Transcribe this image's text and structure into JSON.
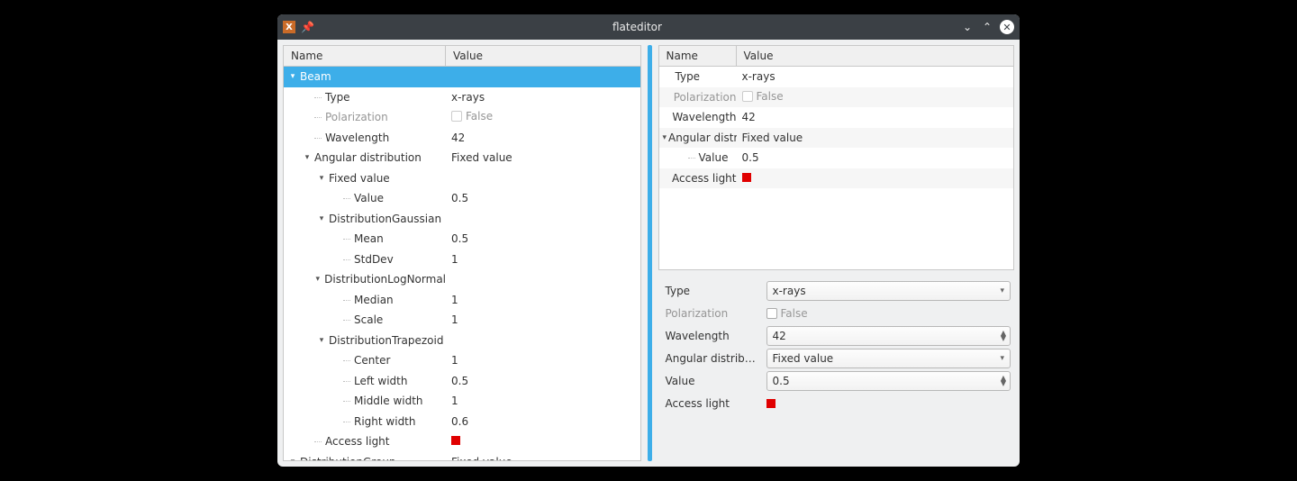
{
  "window": {
    "title": "flateditor"
  },
  "headers": {
    "name": "Name",
    "value": "Value"
  },
  "checkbox_false_label": "False",
  "left_tree": [
    {
      "depth": 0,
      "expander": "down",
      "label": "Beam",
      "value": "",
      "selected": true
    },
    {
      "depth": 1,
      "expander": "",
      "label": "Type",
      "value": "x-rays"
    },
    {
      "depth": 1,
      "expander": "",
      "label": "Polarization",
      "value_type": "checkbox_false",
      "disabled": true
    },
    {
      "depth": 1,
      "expander": "",
      "label": "Wavelength",
      "value": "42"
    },
    {
      "depth": 1,
      "expander": "down",
      "label": "Angular distribution",
      "value": "Fixed value"
    },
    {
      "depth": 2,
      "expander": "down",
      "label": "Fixed value",
      "value": ""
    },
    {
      "depth": 3,
      "expander": "",
      "label": "Value",
      "value": "0.5",
      "last": true
    },
    {
      "depth": 2,
      "expander": "down",
      "label": "DistributionGaussian",
      "value": ""
    },
    {
      "depth": 3,
      "expander": "",
      "label": "Mean",
      "value": "0.5"
    },
    {
      "depth": 3,
      "expander": "",
      "label": "StdDev",
      "value": "1",
      "last": true
    },
    {
      "depth": 2,
      "expander": "down",
      "label": "DistributionLogNormal",
      "value": ""
    },
    {
      "depth": 3,
      "expander": "",
      "label": "Median",
      "value": "1"
    },
    {
      "depth": 3,
      "expander": "",
      "label": "Scale",
      "value": "1",
      "last": true
    },
    {
      "depth": 2,
      "expander": "down",
      "label": "DistributionTrapezoid",
      "value": ""
    },
    {
      "depth": 3,
      "expander": "",
      "label": "Center",
      "value": "1"
    },
    {
      "depth": 3,
      "expander": "",
      "label": "Left width",
      "value": "0.5"
    },
    {
      "depth": 3,
      "expander": "",
      "label": "Middle width",
      "value": "1"
    },
    {
      "depth": 3,
      "expander": "",
      "label": "Right width",
      "value": "0.6",
      "last": true
    },
    {
      "depth": 1,
      "expander": "",
      "label": "Access light",
      "value_type": "color",
      "color": "#e00000"
    },
    {
      "depth": 0,
      "expander": "down",
      "label": "DistributionGroup",
      "value": "Fixed value"
    }
  ],
  "right_tree": [
    {
      "depth": 0,
      "label": "Type",
      "value": "x-rays"
    },
    {
      "depth": 0,
      "label": "Polarization",
      "value_type": "checkbox_false",
      "disabled": true,
      "striped": true
    },
    {
      "depth": 0,
      "label": "Wavelength",
      "value": "42"
    },
    {
      "depth": 0,
      "label": "Angular distri...",
      "value": "Fixed value",
      "expander": "down",
      "striped": true
    },
    {
      "depth": 1,
      "label": "Value",
      "value": "0.5",
      "last": true
    },
    {
      "depth": 0,
      "label": "Access light",
      "value_type": "color",
      "color": "#e00000",
      "striped": true
    }
  ],
  "form": [
    {
      "label": "Type",
      "value": "x-rays",
      "kind": "dropdown"
    },
    {
      "label": "Polarization",
      "value": "False",
      "kind": "checkbox_false",
      "disabled": true
    },
    {
      "label": "Wavelength",
      "value": "42",
      "kind": "spin"
    },
    {
      "label": "Angular distribution",
      "value": "Fixed value",
      "kind": "dropdown"
    },
    {
      "label": "Value",
      "value": "0.5",
      "kind": "spin"
    },
    {
      "label": "Access light",
      "kind": "color",
      "color": "#e00000"
    }
  ]
}
